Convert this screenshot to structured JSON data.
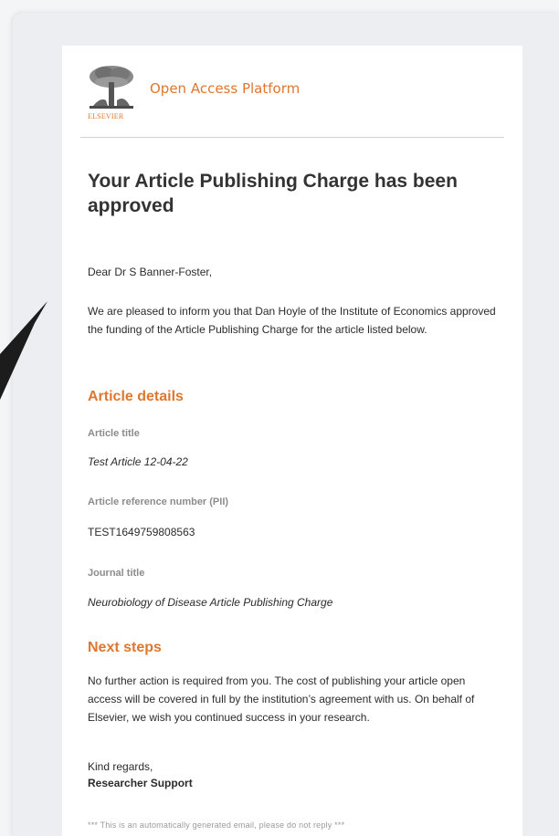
{
  "brand": {
    "logo_word": "ELSEVIER",
    "platform_name": "Open Access Platform",
    "accent_color": "#e1762e"
  },
  "email": {
    "title": "Your Article Publishing Charge has been approved",
    "greeting": "Dear Dr S Banner-Foster,",
    "intro": "We are pleased to inform you that Dan Hoyle of the Institute of Economics approved the funding of the Article Publishing Charge for the article listed below.",
    "article_details": {
      "heading": "Article details",
      "fields": [
        {
          "label": "Article title",
          "value": "Test Article 12-04-22"
        },
        {
          "label": "Article reference number (PII)",
          "value": "TEST1649759808563"
        },
        {
          "label": "Journal title",
          "value": "Neurobiology of Disease Article Publishing Charge"
        }
      ]
    },
    "next_steps": {
      "heading": "Next steps",
      "body": "No further action is required from you. The cost of publishing your article open access will be covered in full by the institution’s agreement with us. On behalf of Elsevier, we wish you continued success in your research."
    },
    "sign_off": {
      "closing": "Kind regards,",
      "signature": "Researcher Support"
    },
    "footer_note": "*** This is an automatically generated email, please do not reply ***"
  },
  "icons": {
    "logo": "elsevier-tree-logo-icon",
    "pointer": "pointer-arrow-icon"
  }
}
